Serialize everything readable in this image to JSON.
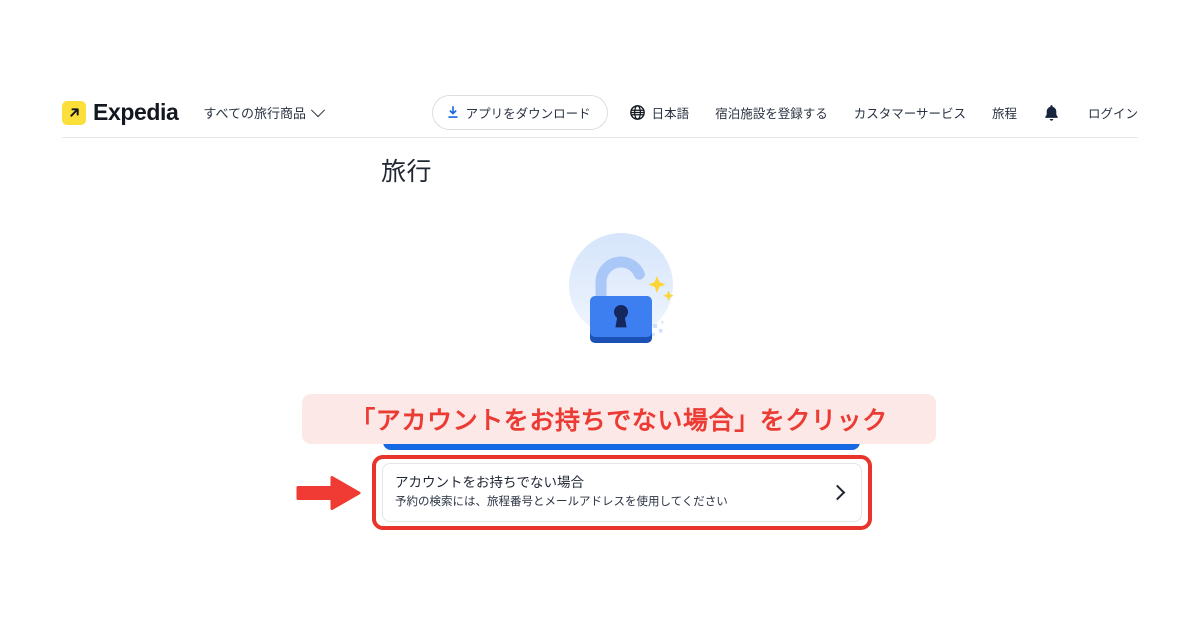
{
  "colors": {
    "brand_yellow": "#fcdf3a",
    "brand_dark": "#13171f",
    "accent_blue": "#1668e3",
    "callout_red": "#ec3b34",
    "callout_bg_pink": "#fce9e7",
    "highlight_red": "#e8352c",
    "page_bg": "#ffffff"
  },
  "header": {
    "brand": {
      "name": "Expedia",
      "logo_icon": "expedia-arrow-icon"
    },
    "products_menu": {
      "label": "すべての旅行商品",
      "chevron_icon": "chevron-down-icon"
    },
    "app_download": {
      "label": "アプリをダウンロード",
      "icon": "download-icon"
    },
    "language": {
      "label": "日本語",
      "icon": "globe-icon"
    },
    "items": [
      {
        "label": "宿泊施設を登録する",
        "name": "list-your-property"
      },
      {
        "label": "カスタマーサービス",
        "name": "customer-service"
      },
      {
        "label": "旅程",
        "name": "trips"
      }
    ],
    "notifications": {
      "icon": "bell-icon",
      "label": ""
    },
    "signin": {
      "label": "ログイン"
    }
  },
  "main": {
    "page_title": "旅行",
    "illustration": {
      "icon": "padlock-sparkle-icon",
      "lock_body_color": "#3d7ff0",
      "lock_shackle_color": "#a9c8f7",
      "keyhole_color": "#16275e",
      "sparkle_color": "#fcd535",
      "halo_color": "#dce8fb"
    },
    "signin_button": {
      "label": ""
    },
    "guest_card": {
      "title": "アカウントをお持ちでない場合",
      "subtitle": "予約の検索には、旅程番号とメールアドレスを使用してください",
      "chevron_icon": "chevron-right-icon"
    }
  },
  "annotations": {
    "banner_text": "「アカウントをお持ちでない場合」をクリック",
    "arrow_icon": "red-arrow-right-icon",
    "highlight_box": "red-highlight-rectangle"
  }
}
